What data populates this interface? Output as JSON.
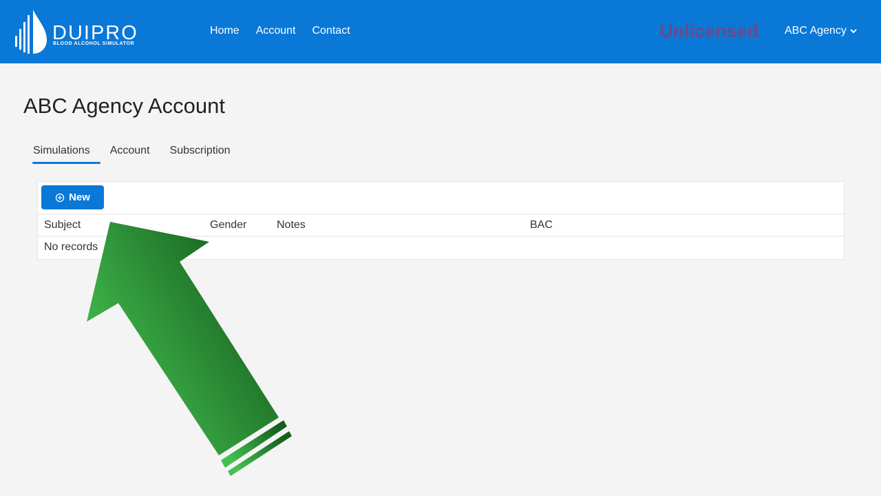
{
  "navbar": {
    "logo_title": "DUIPRO",
    "logo_subtitle": "BLOOD ALCOHOL SIMULATOR",
    "links": [
      {
        "label": "Home"
      },
      {
        "label": "Account"
      },
      {
        "label": "Contact"
      }
    ],
    "license_status": "Unlicensed",
    "user_menu": "ABC Agency",
    "brand_color": "#0a78d7"
  },
  "page": {
    "title": "ABC Agency Account",
    "tabs": [
      {
        "label": "Simulations",
        "active": true
      },
      {
        "label": "Account",
        "active": false
      },
      {
        "label": "Subscription",
        "active": false
      }
    ]
  },
  "simulations": {
    "new_button": "New",
    "columns": [
      "Subject",
      "Gender",
      "Notes",
      "BAC"
    ],
    "empty_message": "No records"
  },
  "annotation": {
    "type": "arrow",
    "color": "#2e9e3e",
    "points_to": "new-button"
  }
}
